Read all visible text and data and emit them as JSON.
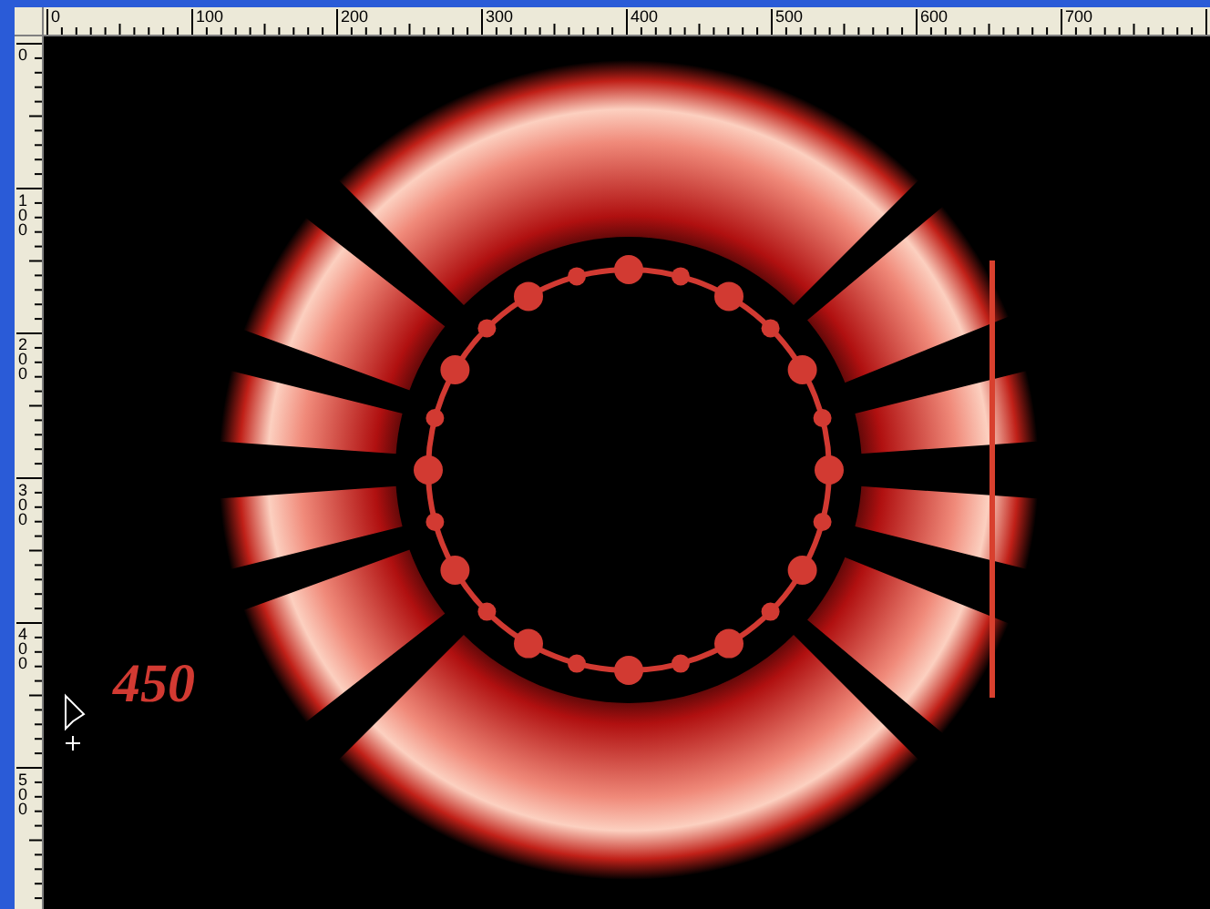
{
  "rulers": {
    "horizontal": {
      "labels": [
        "0",
        "100",
        "200",
        "300",
        "400",
        "500",
        "600",
        "700"
      ]
    },
    "vertical": {
      "labels": [
        "0",
        "100",
        "200",
        "300",
        "400",
        "500"
      ]
    }
  },
  "canvas": {
    "annotation": "450"
  }
}
